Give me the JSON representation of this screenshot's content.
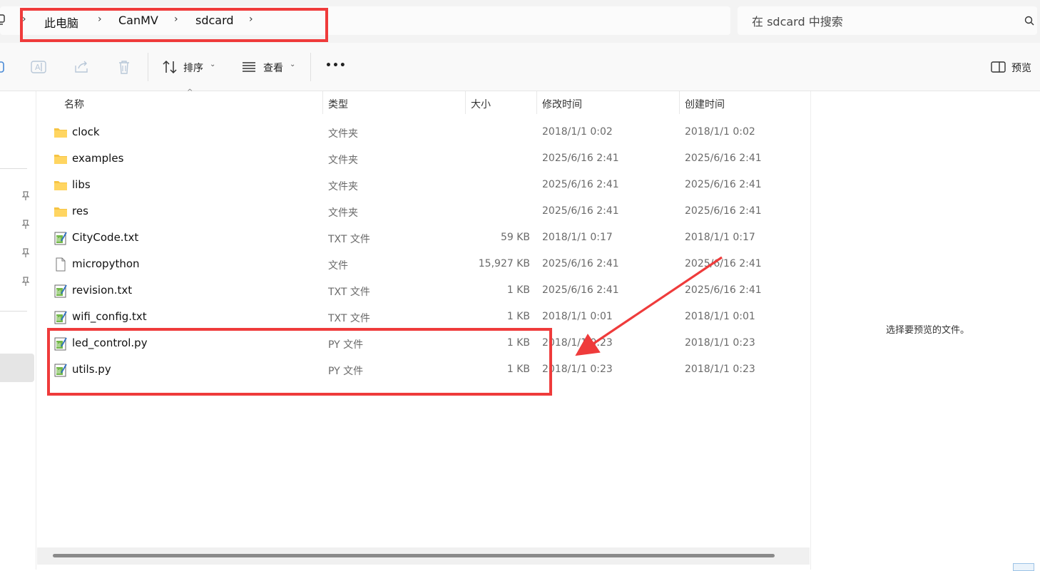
{
  "breadcrumb": {
    "items": [
      "此电脑",
      "CanMV",
      "sdcard"
    ]
  },
  "search": {
    "placeholder": "在 sdcard 中搜索"
  },
  "toolbar": {
    "sort_label": "排序",
    "view_label": "查看",
    "more_label": "•••",
    "preview_label": "预览"
  },
  "columns": {
    "name": "名称",
    "type": "类型",
    "size": "大小",
    "modified": "修改时间",
    "created": "创建时间"
  },
  "files": [
    {
      "name": "clock",
      "type": "文件夹",
      "size": "",
      "modified": "2018/1/1 0:02",
      "created": "2018/1/1 0:02",
      "icon": "folder-icon"
    },
    {
      "name": "examples",
      "type": "文件夹",
      "size": "",
      "modified": "2025/6/16 2:41",
      "created": "2025/6/16 2:41",
      "icon": "folder-icon"
    },
    {
      "name": "libs",
      "type": "文件夹",
      "size": "",
      "modified": "2025/6/16 2:41",
      "created": "2025/6/16 2:41",
      "icon": "folder-icon"
    },
    {
      "name": "res",
      "type": "文件夹",
      "size": "",
      "modified": "2025/6/16 2:41",
      "created": "2025/6/16 2:41",
      "icon": "folder-icon"
    },
    {
      "name": "CityCode.txt",
      "type": "TXT 文件",
      "size": "59 KB",
      "modified": "2018/1/1 0:17",
      "created": "2018/1/1 0:17",
      "icon": "notepad-file-icon"
    },
    {
      "name": "micropython",
      "type": "文件",
      "size": "15,927 KB",
      "modified": "2025/6/16 2:41",
      "created": "2025/6/16 2:41",
      "icon": "blank-file-icon"
    },
    {
      "name": "revision.txt",
      "type": "TXT 文件",
      "size": "1 KB",
      "modified": "2025/6/16 2:41",
      "created": "2025/6/16 2:41",
      "icon": "notepad-file-icon"
    },
    {
      "name": "wifi_config.txt",
      "type": "TXT 文件",
      "size": "1 KB",
      "modified": "2018/1/1 0:01",
      "created": "2018/1/1 0:01",
      "icon": "notepad-file-icon"
    },
    {
      "name": "led_control.py",
      "type": "PY 文件",
      "size": "1 KB",
      "modified": "2018/1/1 0:23",
      "created": "2018/1/1 0:23",
      "icon": "notepad-file-icon"
    },
    {
      "name": "utils.py",
      "type": "PY 文件",
      "size": "1 KB",
      "modified": "2018/1/1 0:23",
      "created": "2018/1/1 0:23",
      "icon": "notepad-file-icon"
    }
  ],
  "preview": {
    "empty_message": "选择要预览的文件。"
  },
  "colors": {
    "annotation_red": "#ef3b3b",
    "folder_yellow": "#f6c443"
  }
}
